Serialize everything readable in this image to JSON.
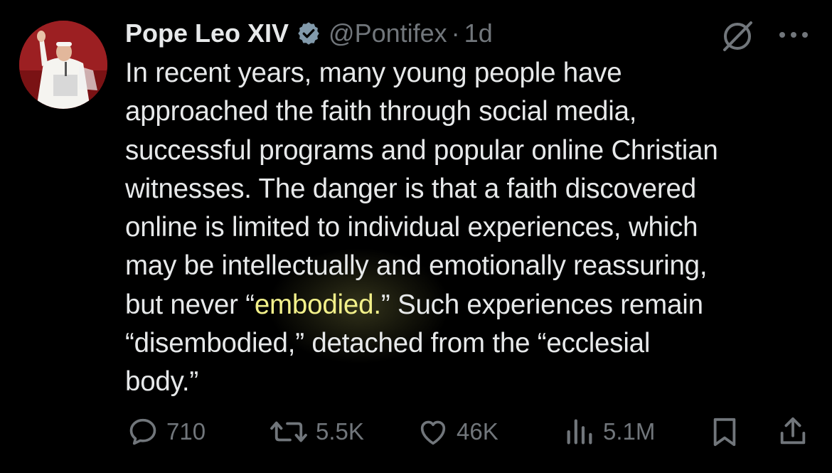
{
  "author": {
    "display_name": "Pope Leo XIV",
    "handle": "@Pontifex",
    "separator": "·",
    "time": "1d",
    "verified_icon": "verified-badge-icon",
    "verified_color": "#829aab"
  },
  "post": {
    "lines": [
      "In recent years, many young people have",
      "approached the faith through social media,",
      "successful programs and popular online Christian",
      "witnesses. The danger is that a faith discovered",
      "online is limited to individual experiences, which",
      "may be intellectually and emotionally reassuring,",
      "but never “embodied.” Such experiences remain",
      "“disembodied,” detached from the “ecclesial",
      "body.”"
    ],
    "line7_before": "but never “",
    "line7_highlight": "embodied.",
    "line7_after": "” Such experiences remain"
  },
  "actions": {
    "replies": "710",
    "reposts": "5.5K",
    "likes": "46K",
    "views": "5.1M"
  },
  "icons": {
    "grok": "grok-icon",
    "more": "more-icon",
    "reply": "reply-icon",
    "repost": "repost-icon",
    "like": "heart-icon",
    "views": "views-chart-icon",
    "bookmark": "bookmark-icon",
    "share": "share-icon"
  },
  "colors": {
    "background": "#000000",
    "text": "#e7e9ea",
    "muted": "#71767b"
  }
}
